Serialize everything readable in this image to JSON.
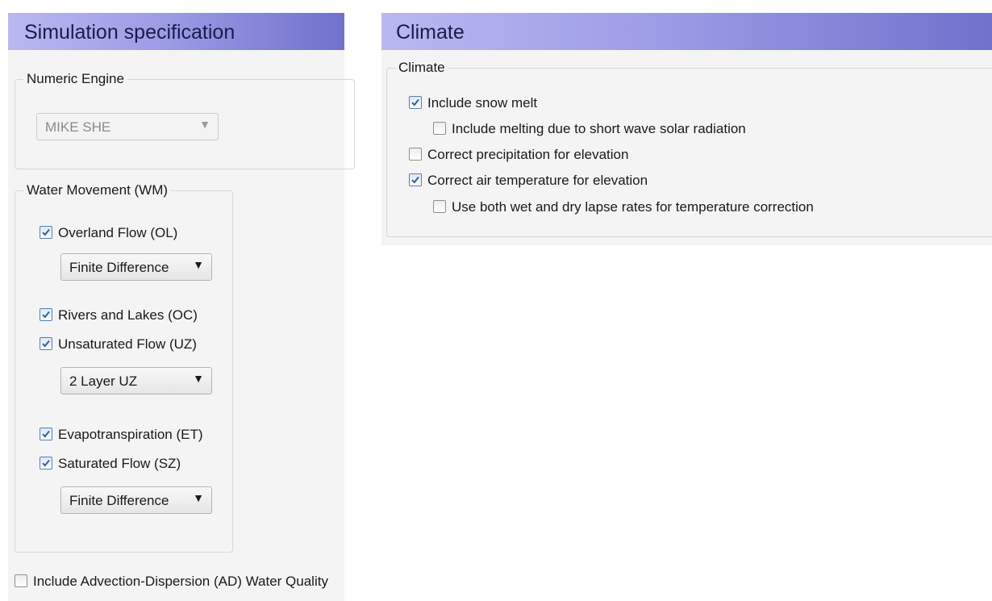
{
  "simulation": {
    "title": "Simulation specification",
    "numeric_engine": {
      "legend": "Numeric Engine",
      "value": "MIKE SHE"
    },
    "water_movement": {
      "legend": "Water Movement (WM)",
      "overland_flow": {
        "label": "Overland Flow (OL)",
        "checked": true
      },
      "overland_method": "Finite Difference",
      "rivers_lakes": {
        "label": "Rivers and Lakes (OC)",
        "checked": true
      },
      "unsaturated_flow": {
        "label": "Unsaturated Flow (UZ)",
        "checked": true
      },
      "unsaturated_method": "2 Layer UZ",
      "evapotranspiration": {
        "label": "Evapotranspiration (ET)",
        "checked": true
      },
      "saturated_flow": {
        "label": "Saturated Flow (SZ)",
        "checked": true
      },
      "saturated_method": "Finite Difference"
    },
    "advection_dispersion": {
      "label": "Include Advection-Dispersion (AD) Water Quality",
      "checked": false
    }
  },
  "climate": {
    "title": "Climate",
    "group_legend": "Climate",
    "snow_melt": {
      "label": "Include snow melt",
      "checked": true
    },
    "short_wave": {
      "label": "Include melting due to short wave solar radiation",
      "checked": false
    },
    "precip_elevation": {
      "label": "Correct precipitation for elevation",
      "checked": false
    },
    "air_temp_elevation": {
      "label": "Correct air temperature for elevation",
      "checked": true
    },
    "lapse_rates": {
      "label": "Use both wet and dry lapse rates for temperature correction",
      "checked": false
    }
  },
  "icons": {
    "dropdown": "chevron-down-icon",
    "check": "checkmark-icon"
  },
  "colors": {
    "title_gradient_start": "#b9b8f1",
    "title_gradient_end": "#7171cd",
    "check_mark": "#3c5d8f"
  }
}
